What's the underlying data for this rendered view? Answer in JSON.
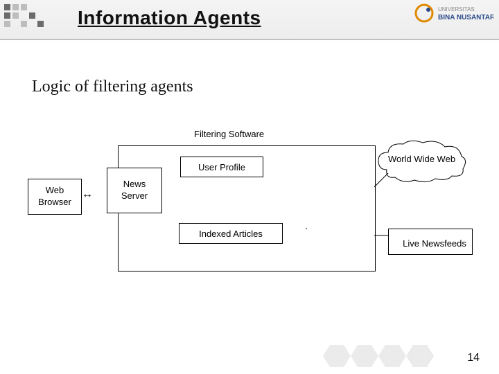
{
  "header": {
    "title": "Information Agents",
    "logo_university": "UNIVERSITAS",
    "logo_name": "BINA NUSANTARA"
  },
  "subtitle": "Logic of filtering agents",
  "diagram": {
    "filtering_software": "Filtering Software",
    "user_profile": "User Profile",
    "indexed_articles": "Indexed Articles",
    "web_browser_l1": "Web",
    "web_browser_l2": "Browser",
    "news_server_l1": "News",
    "news_server_l2": "Server",
    "world_wide_web": "World Wide Web",
    "live_newsfeeds": "Live Newsfeeds"
  },
  "page_number": "14"
}
